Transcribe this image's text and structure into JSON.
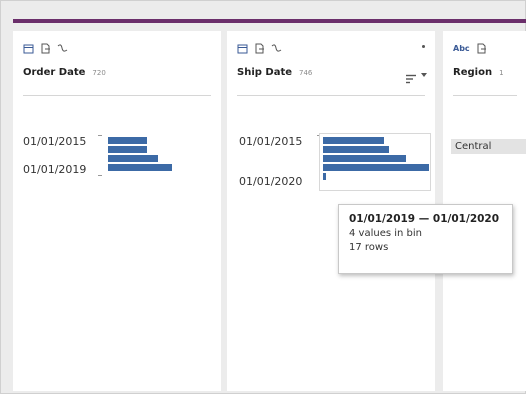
{
  "colors": {
    "accent_bar": "#6b2f6b",
    "histogram_bar": "#3c6aa6",
    "card_background": "#ffffff",
    "canvas_background": "#ececec"
  },
  "columns": [
    {
      "title": "Order Date",
      "count": "720",
      "icons": [
        "calendar-icon",
        "file-icon",
        "field-change-icon"
      ],
      "labels": [
        "01/01/2015",
        "01/01/2019"
      ],
      "histogram_bins": [
        0.82,
        0.82,
        1.06,
        1.36
      ]
    },
    {
      "title": "Ship Date",
      "count": "746",
      "icons": [
        "calendar-icon",
        "file-icon",
        "field-change-icon",
        "more-icon",
        "sort-icon"
      ],
      "labels": [
        "01/01/2015",
        "01/01/2020"
      ],
      "histogram_bins": [
        0.76,
        0.82,
        1.04,
        1.32,
        0.04
      ]
    },
    {
      "title": "Region",
      "count": "1",
      "icons": [
        "string-type-icon",
        "file-icon"
      ],
      "values": [
        "Central"
      ]
    }
  ],
  "tooltip": {
    "title": "01/01/2019 — 01/01/2020",
    "line1": "4 values in bin",
    "line2": "17 rows"
  }
}
